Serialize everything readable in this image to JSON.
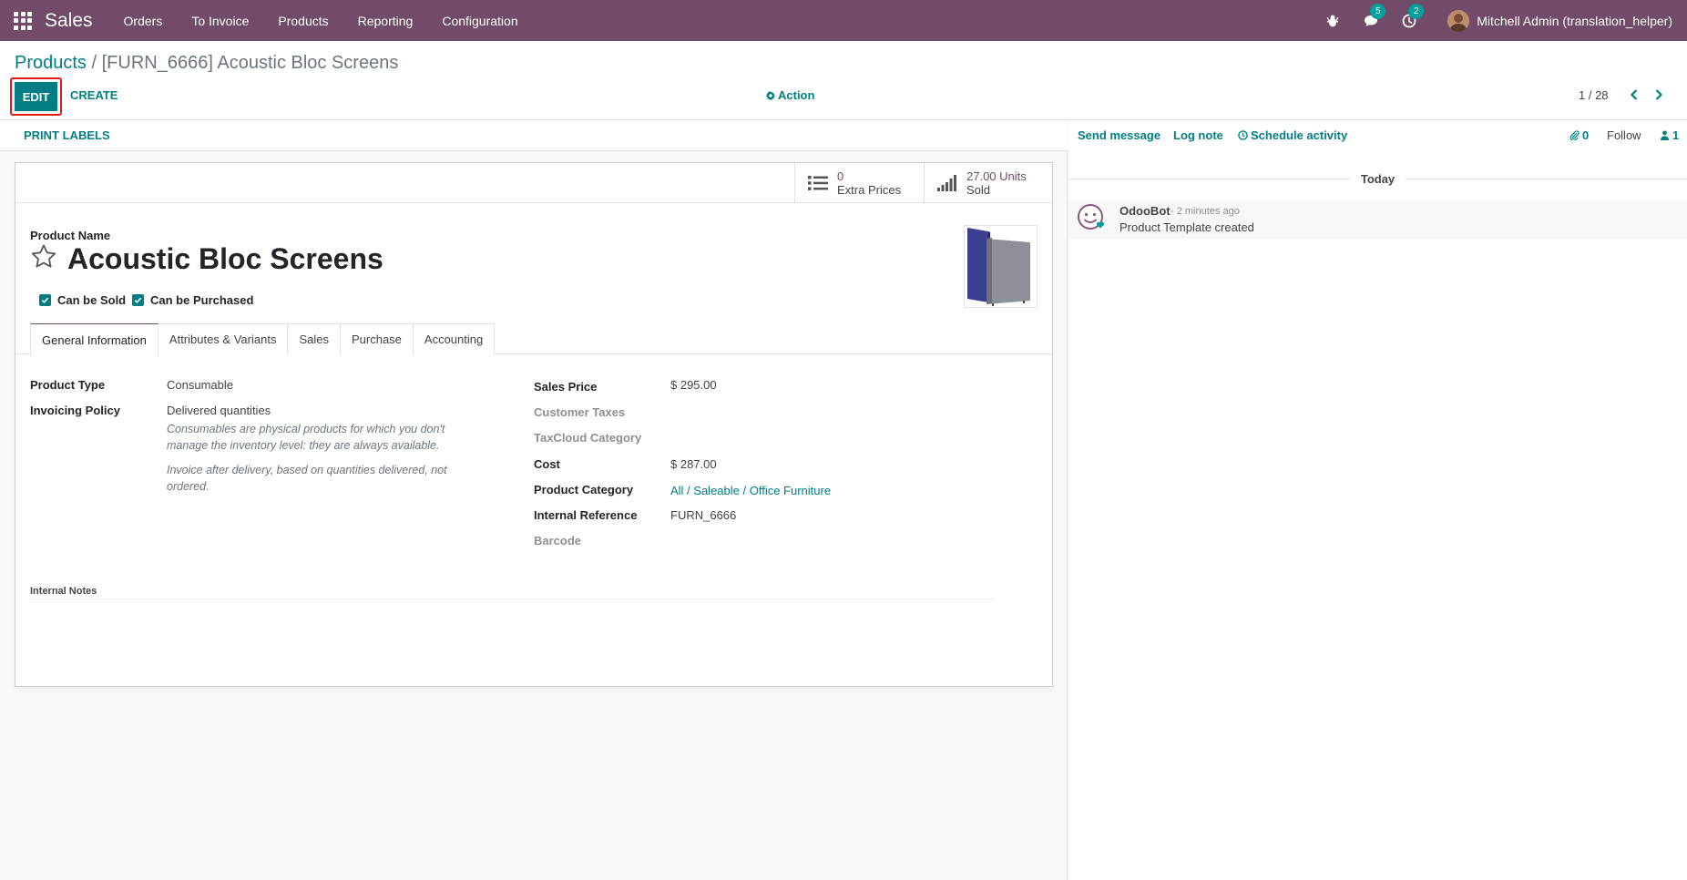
{
  "navbar": {
    "app_name": "Sales",
    "menu": [
      "Orders",
      "To Invoice",
      "Products",
      "Reporting",
      "Configuration"
    ],
    "messages_count": "5",
    "activities_count": "2",
    "user_name": "Mitchell Admin (translation_helper)"
  },
  "control": {
    "breadcrumb_root": "Products",
    "breadcrumb_separator": "/",
    "breadcrumb_current": "[FURN_6666] Acoustic Bloc Screens",
    "edit_label": "EDIT",
    "create_label": "CREATE",
    "action_label": "Action",
    "pager": "1 / 28"
  },
  "statusbar": {
    "print_labels": "PRINT LABELS"
  },
  "stats": {
    "extra_prices_value": "0",
    "extra_prices_label": "Extra Prices",
    "units_sold_value": "27.00 Units",
    "units_sold_label": "Sold"
  },
  "product": {
    "name_label": "Product Name",
    "name": "Acoustic Bloc Screens",
    "can_be_sold": "Can be Sold",
    "can_be_purchased": "Can be Purchased"
  },
  "tabs": [
    "General Information",
    "Attributes & Variants",
    "Sales",
    "Purchase",
    "Accounting"
  ],
  "general": {
    "product_type_label": "Product Type",
    "product_type": "Consumable",
    "invoicing_policy_label": "Invoicing Policy",
    "invoicing_policy": "Delivered quantities",
    "help_consumable": "Consumables are physical products for which you don't manage the inventory level: they are always available.",
    "help_invoice": "Invoice after delivery, based on quantities delivered, not ordered.",
    "sales_price_label": "Sales Price",
    "sales_price": "$ 295.00",
    "customer_taxes_label": "Customer Taxes",
    "taxcloud_label": "TaxCloud Category",
    "cost_label": "Cost",
    "cost": "$ 287.00",
    "product_category_label": "Product Category",
    "product_category": "All / Saleable / Office Furniture",
    "internal_ref_label": "Internal Reference",
    "internal_ref": "FURN_6666",
    "barcode_label": "Barcode",
    "internal_notes_label": "Internal Notes"
  },
  "chatter": {
    "send_message": "Send message",
    "log_note": "Log note",
    "schedule_activity": "Schedule activity",
    "attachments": "0",
    "follow": "Follow",
    "followers": "1",
    "today": "Today",
    "message": {
      "author": "OdooBot",
      "time": "- 2 minutes ago",
      "body": "Product Template created"
    }
  }
}
